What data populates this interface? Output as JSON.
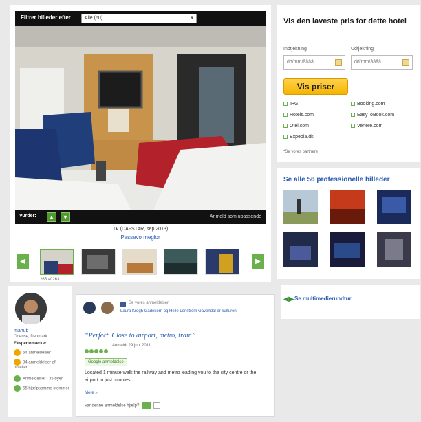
{
  "viewer": {
    "filter_label": "Filtrer billeder efter",
    "filter_value": "Alle (60)",
    "vote_label": "Vurder:",
    "report_link": "Anmeld som upassende",
    "caption_prefix": "TV",
    "caption_suffix": "(DAFSTAR, sep 2013)",
    "helpful_link": "Passevo meglor",
    "thumb_count": "265 af 263"
  },
  "price_panel": {
    "title": "Vis den laveste pris for dette hotel",
    "checkin_label": "Indtjekning",
    "checkout_label": "Udtjekning",
    "checkin_placeholder": "dd/mm/åååå",
    "checkout_placeholder": "dd/mm/åååå",
    "button_label": "Vis priser",
    "partners_left": [
      "IHG",
      "Hotels.com",
      "Otel.com",
      "Expedia.dk"
    ],
    "partners_right": [
      "Booking.com",
      "EasyToBook.com",
      "Venere.com"
    ],
    "partners_note": "*Se vores partnere"
  },
  "pro_panel": {
    "title": "Se alle 56 professionelle billeder"
  },
  "tour": {
    "link": "Se multimedierundtur"
  },
  "reviewer": {
    "name": "mahub",
    "location": "Odense, Danmark",
    "badges_title": "Ekspertemærker",
    "badges": [
      {
        "label": "64 anmeldelser",
        "color": "#f0a500"
      },
      {
        "label": "34 anmeldelser af hoteller",
        "color": "#f0a500"
      },
      {
        "label": "Anmeldelser i 35 byer",
        "color": "#6ab04c"
      },
      {
        "label": "55 hjælpsomme stemmer",
        "color": "#6ab04c"
      }
    ]
  },
  "review": {
    "friends_line": "Se vores anmeldelser",
    "friends_names": "Laura Krogh Gadekorn og Helle Lönström Gavendal er kulturen",
    "quote": "“Perfect. Close to airport, metro, train”",
    "date": "Anmeldt 29 juni 2011",
    "tag": "Google anmeldelse",
    "body": "Located 1 minute walk the railway and metro leading you to the city centre or the airport in just minutes....",
    "more": "Mere »",
    "helpful_prompt": "Var denne anmeldelse hjælp?"
  },
  "colors": {
    "accent_green": "#6ab04c",
    "link_blue": "#2a5db0",
    "button_yellow": "#f5b400"
  }
}
